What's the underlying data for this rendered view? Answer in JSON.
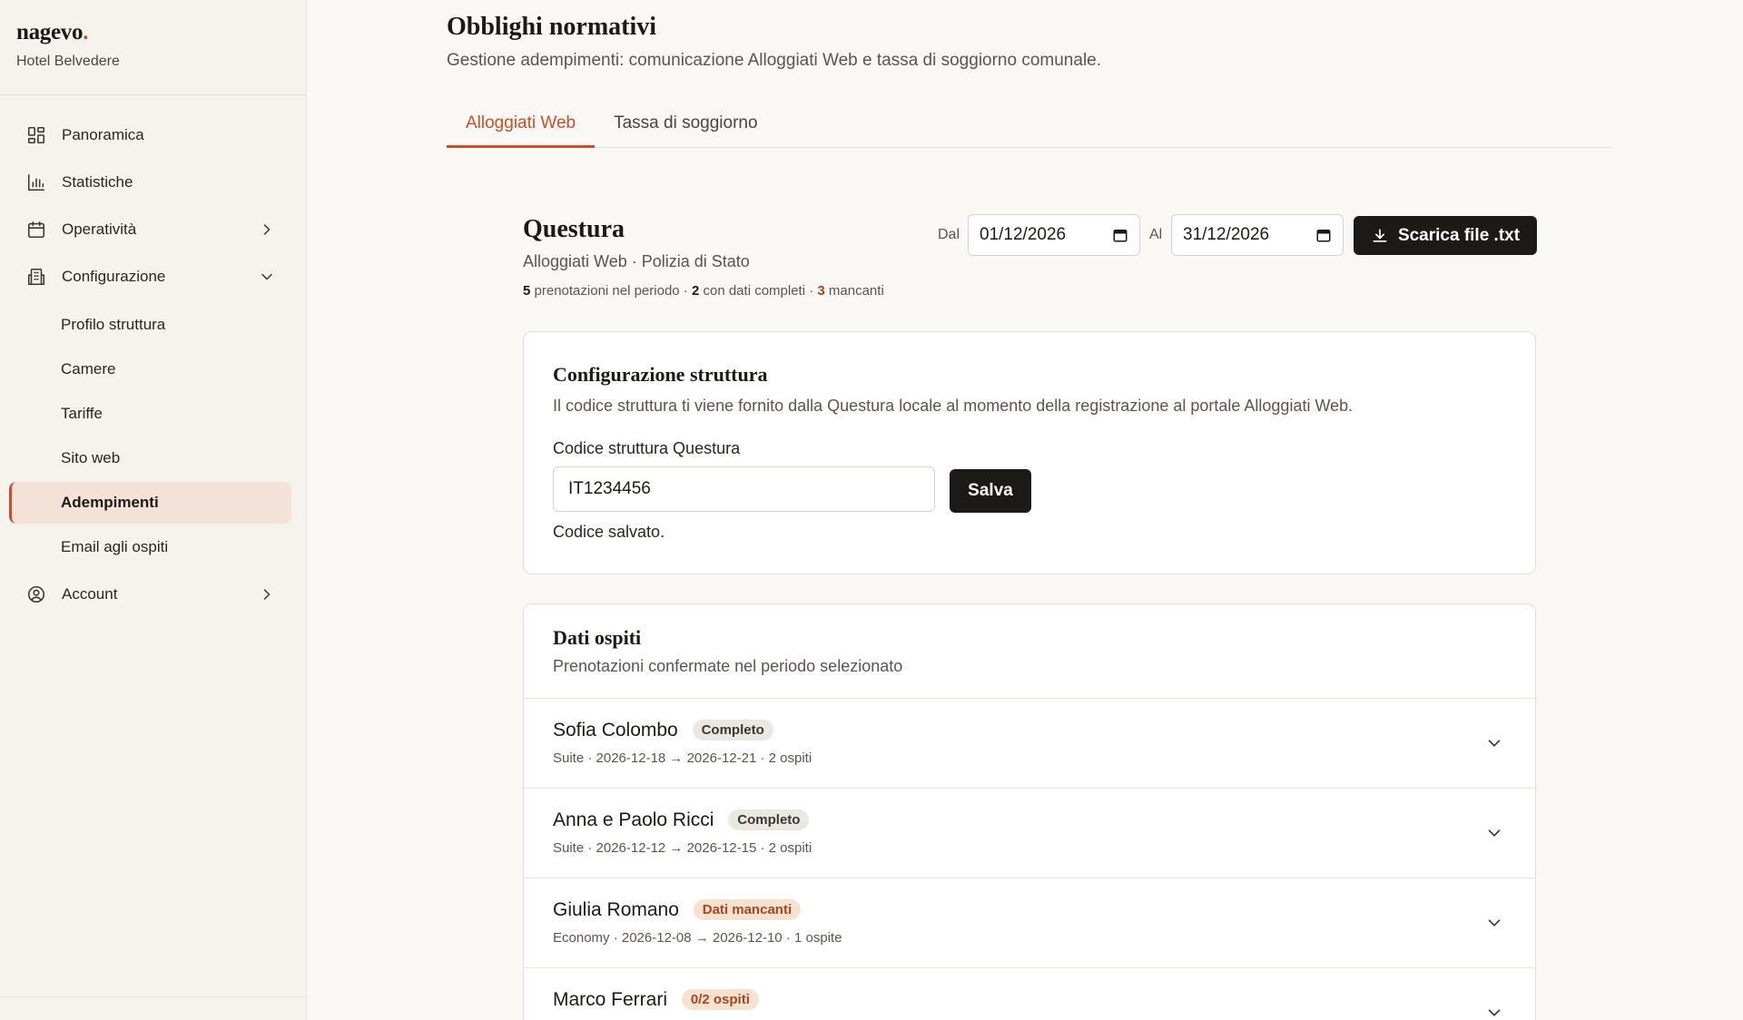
{
  "brand": {
    "logo": "nagevo",
    "logo_dot": ".",
    "hotel": "Hotel Belvedere"
  },
  "sidebar": {
    "items": [
      {
        "label": "Panoramica",
        "icon": "dashboard-icon"
      },
      {
        "label": "Statistiche",
        "icon": "bar-chart-icon"
      },
      {
        "label": "Operatività",
        "icon": "calendar-icon",
        "caret": "chevron-right-icon"
      },
      {
        "label": "Configurazione",
        "icon": "building-icon",
        "caret": "chevron-down-icon"
      }
    ],
    "subitems": [
      {
        "label": "Profilo struttura"
      },
      {
        "label": "Camere"
      },
      {
        "label": "Tariffe"
      },
      {
        "label": "Sito web"
      },
      {
        "label": "Adempimenti",
        "active": true
      },
      {
        "label": "Email agli ospiti"
      }
    ],
    "account": {
      "label": "Account",
      "icon": "user-circle-icon",
      "caret": "chevron-right-icon"
    }
  },
  "header": {
    "title": "Obblighi normativi",
    "subtitle": "Gestione adempimenti: comunicazione Alloggiati Web e tassa di soggiorno comunale."
  },
  "tabs": [
    {
      "label": "Alloggiati Web",
      "active": true
    },
    {
      "label": "Tassa di soggiorno",
      "active": false
    }
  ],
  "questura": {
    "title": "Questura",
    "subtitle": "Alloggiati Web · Polizia di Stato",
    "counts": {
      "bookings": "5",
      "bookings_text": "prenotazioni nel periodo ·",
      "complete": "2",
      "complete_text": "con dati completi ·",
      "missing": "3",
      "missing_text": "mancanti"
    },
    "from_label": "Dal",
    "from_value": "01/12/2026",
    "to_label": "Al",
    "to_value": "31/12/2026",
    "download_label": "Scarica file .txt"
  },
  "config": {
    "title": "Configurazione struttura",
    "description": "Il codice struttura ti viene fornito dalla Questura locale al momento della registrazione al portale Alloggiati Web.",
    "field_label": "Codice struttura Questura",
    "field_value": "IT1234456",
    "save_label": "Salva",
    "saved_message": "Codice salvato."
  },
  "guests": {
    "title": "Dati ospiti",
    "subtitle": "Prenotazioni confermate nel periodo selezionato",
    "rows": [
      {
        "name": "Sofia Colombo",
        "badge": "Completo",
        "status": "ok",
        "meta": "Suite · 2026-12-18 → 2026-12-21 · 2 ospiti"
      },
      {
        "name": "Anna e Paolo Ricci",
        "badge": "Completo",
        "status": "ok",
        "meta": "Suite · 2026-12-12 → 2026-12-15 · 2 ospiti"
      },
      {
        "name": "Giulia Romano",
        "badge": "Dati mancanti",
        "status": "warn",
        "meta": "Economy · 2026-12-08 → 2026-12-10 · 1 ospite"
      },
      {
        "name": "Marco Ferrari",
        "badge": "0/2 ospiti",
        "status": "warn",
        "meta": ""
      }
    ]
  },
  "colors": {
    "accent": "#c4512b",
    "dark": "#1c1a17",
    "background": "#faf8f4",
    "active_bg": "#f4e1d8",
    "warn_bg": "#f7e2d2"
  }
}
